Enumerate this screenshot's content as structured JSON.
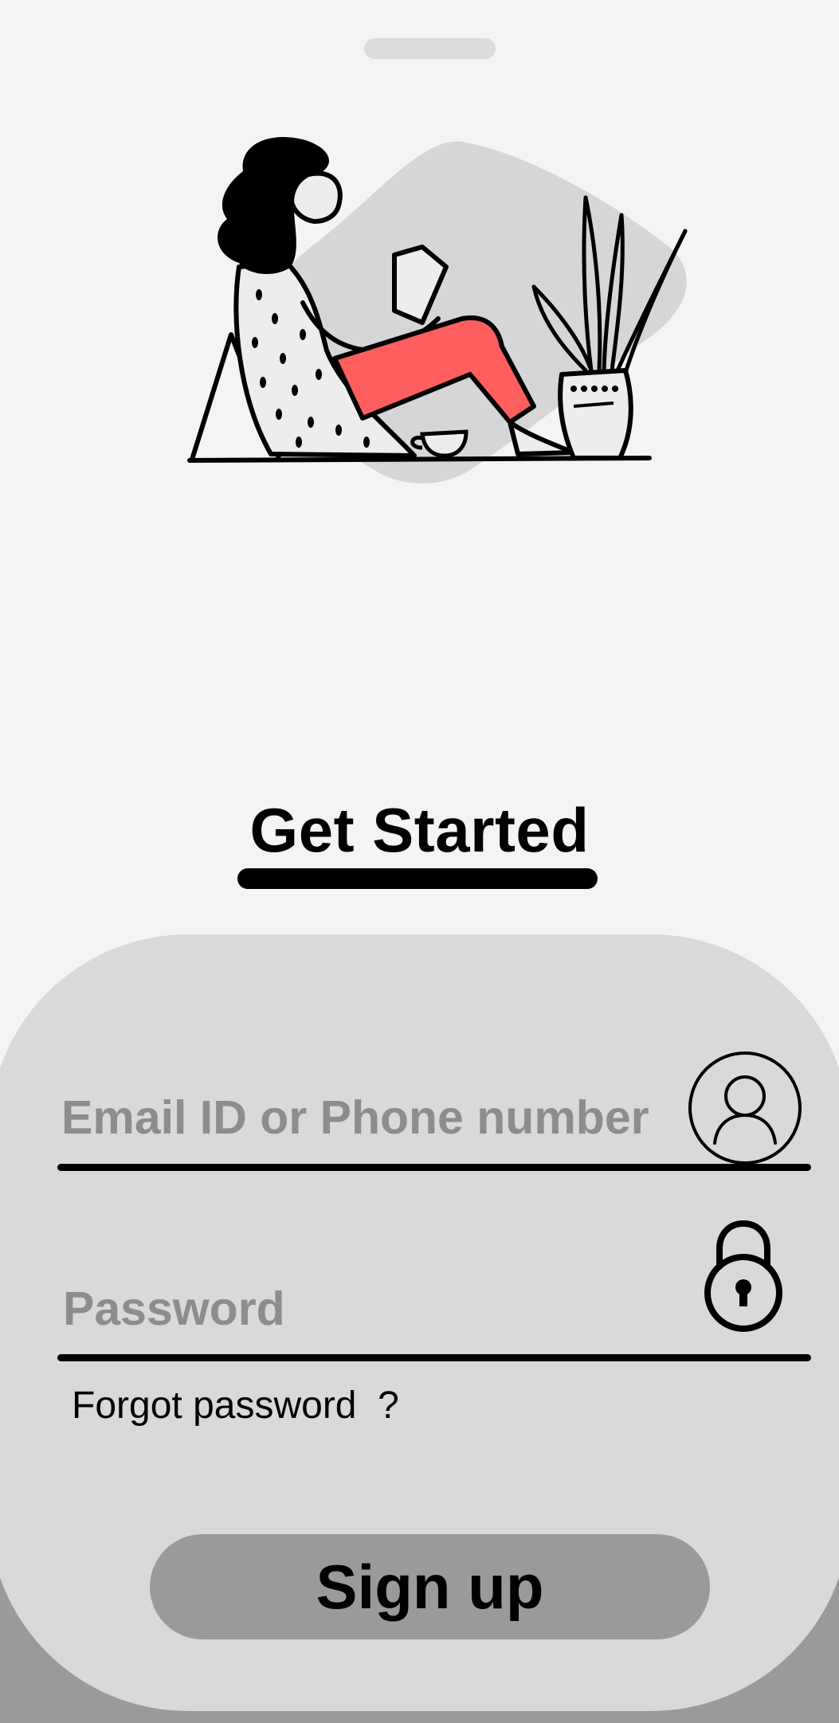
{
  "header": {
    "title": "Get Started"
  },
  "form": {
    "email_placeholder": "Email ID or Phone number",
    "password_placeholder": "Password",
    "forgot_label": "Forgot password  ?",
    "signup_label": "Sign up"
  },
  "icons": {
    "user": "user-icon",
    "lock": "lock-icon",
    "illustration": "woman-reading-illustration"
  },
  "colors": {
    "background": "#f4f4f4",
    "card": "#d9d9d9",
    "button": "#9a9a9a",
    "placeholder": "#8d8d8d",
    "accent": "#ff5e5e"
  }
}
